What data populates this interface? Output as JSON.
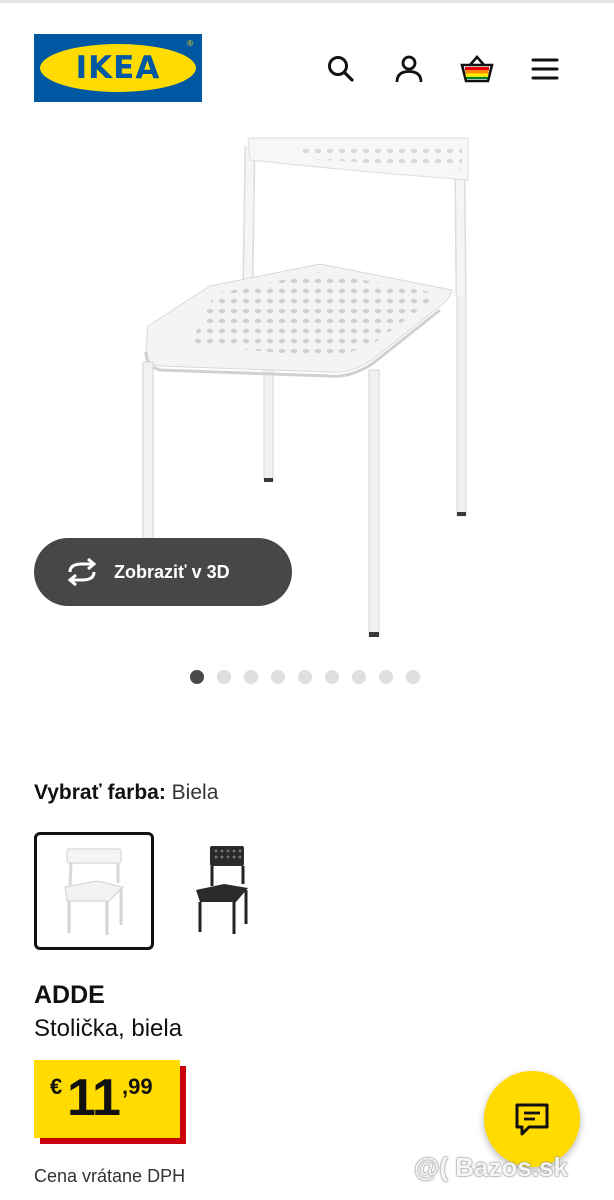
{
  "header": {
    "logo_text": "IKEA",
    "logo_reg": "®",
    "icons": [
      "search-icon",
      "user-icon",
      "basket-icon",
      "menu-icon"
    ]
  },
  "gallery": {
    "view_3d_label": "Zobraziť v 3D",
    "image_count": 9,
    "active_index": 0
  },
  "product": {
    "color_label": "Vybrať farba:",
    "color_value": "Biela",
    "variants": [
      "white-chair",
      "black-chair"
    ],
    "name": "ADDE",
    "description": "Stolička, biela",
    "price_currency": "€",
    "price_integer": "11",
    "price_decimal": ",99",
    "vat_note": "Cena vrátane DPH"
  },
  "watermark": "@( Bazos.sk",
  "colors": {
    "ikea_blue": "#0058a3",
    "ikea_yellow": "#ffdb00",
    "price_red": "#cc0008",
    "pill_gray": "#474747"
  }
}
